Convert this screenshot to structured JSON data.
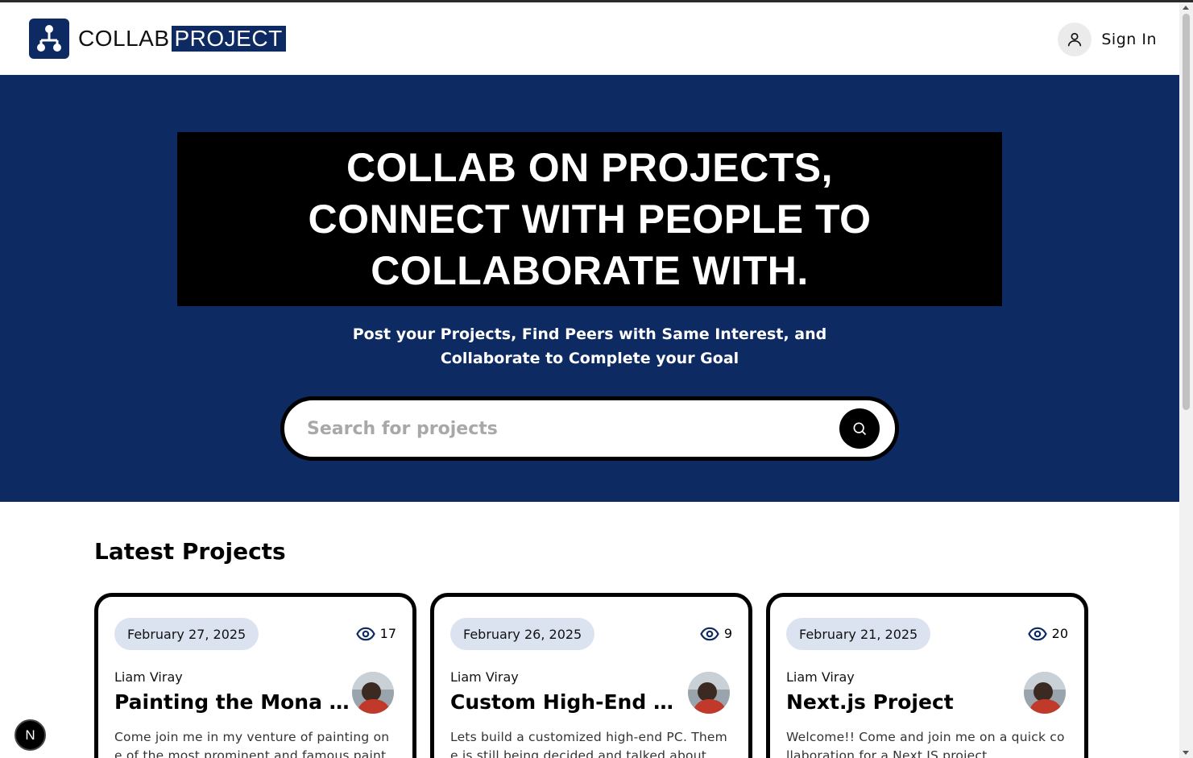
{
  "brand": {
    "part1": "COLLAB",
    "part2": "PROJECT",
    "primary_color": "#0d2a63",
    "icon": "network-nodes-icon"
  },
  "header": {
    "signin_label": "Sign In",
    "user_icon": "user-icon"
  },
  "hero": {
    "title": "COLLAB ON PROJECTS, CONNECT WITH PEOPLE TO COLLABORATE WITH.",
    "subtitle": "Post your Projects, Find Peers with Same Interest, and Collaborate to Complete your Goal",
    "search_placeholder": "Search for projects",
    "search_icon": "search-icon"
  },
  "latest": {
    "title": "Latest Projects",
    "cards": [
      {
        "date": "February 27, 2025",
        "views": "17",
        "author": "Liam Viray",
        "title": "Painting the Mona Lisa",
        "description": "Come join me in my venture of painting one of the most prominent and famous painti..."
      },
      {
        "date": "February 26, 2025",
        "views": "9",
        "author": "Liam Viray",
        "title": "Custom High-End PC...",
        "description": "Lets build a customized high-end PC. Theme is still being decided and talked about. ..."
      },
      {
        "date": "February 21, 2025",
        "views": "20",
        "author": "Liam Viray",
        "title": "Next.js Project",
        "description": "Welcome!! Come and join me on a quick collaboration for a Next.JS project."
      }
    ]
  },
  "dev_badge": {
    "label": "N"
  }
}
